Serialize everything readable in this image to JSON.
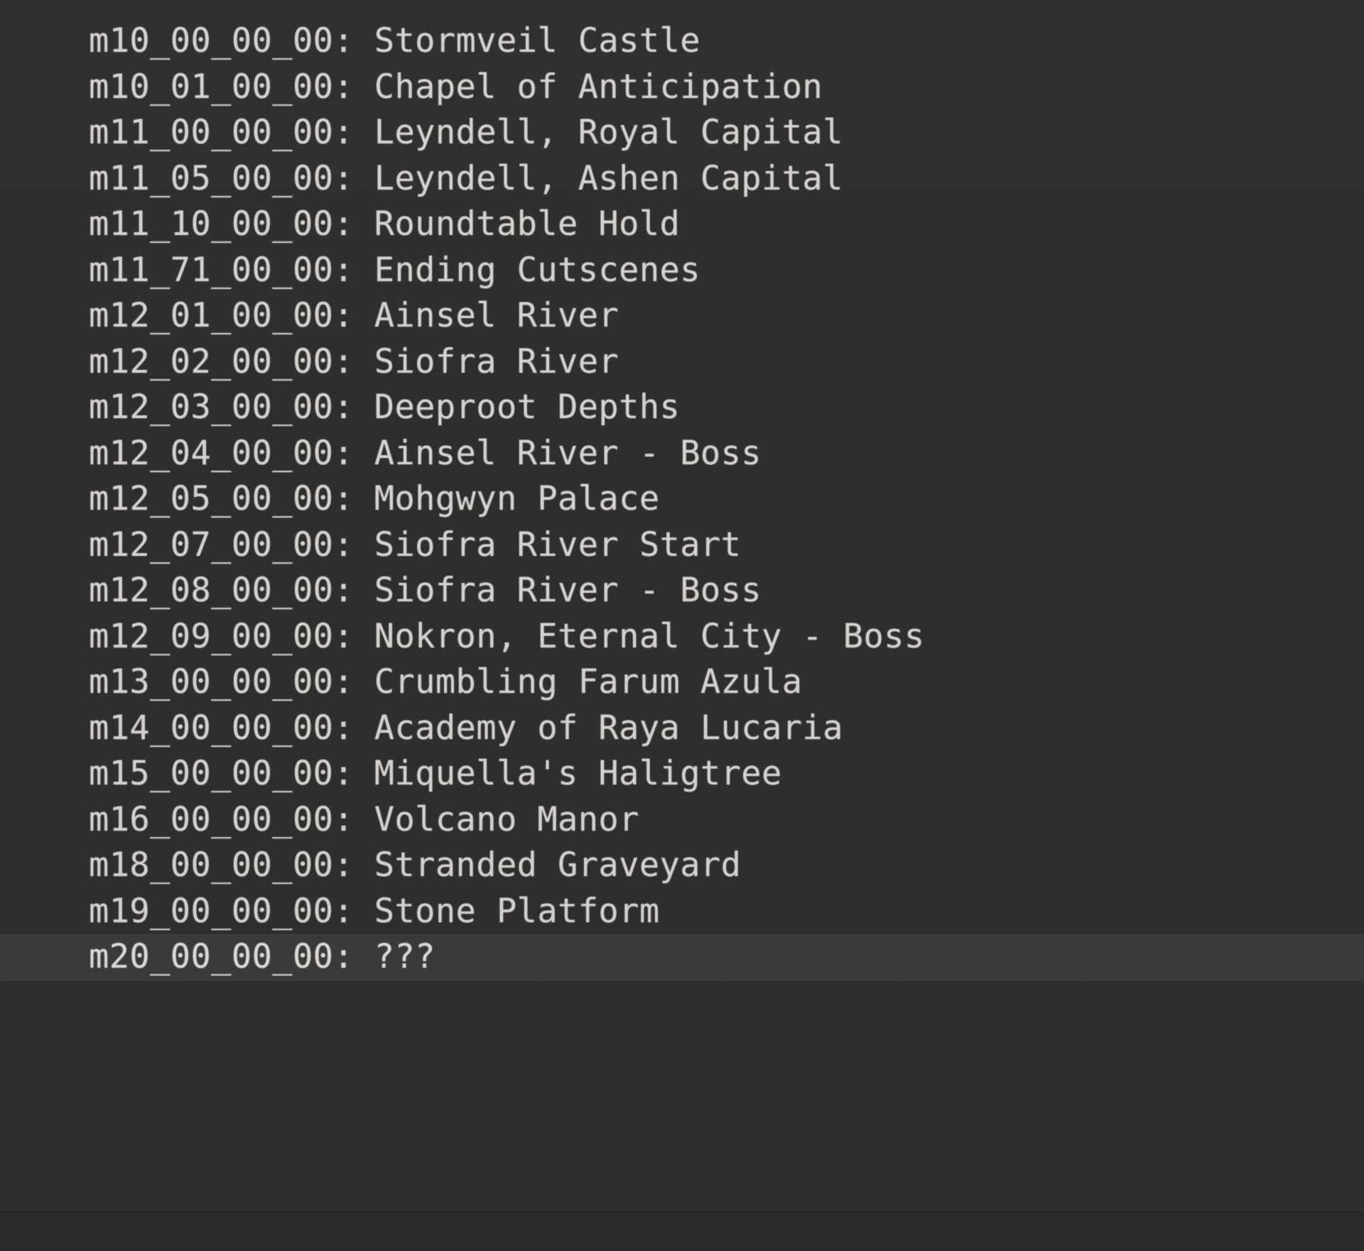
{
  "panel": {
    "background_color": "#2e2e2e",
    "text_color": "#d6d2ce",
    "selected_row_color": "#3a3a3a",
    "footer_color": "#2a2a2a",
    "separator": ": "
  },
  "map_list": {
    "rows": [
      {
        "map_id": "m10_00_00_00",
        "name": "Stormveil Castle",
        "selected": false
      },
      {
        "map_id": "m10_01_00_00",
        "name": "Chapel of Anticipation",
        "selected": false
      },
      {
        "map_id": "m11_00_00_00",
        "name": "Leyndell, Royal Capital",
        "selected": false
      },
      {
        "map_id": "m11_05_00_00",
        "name": "Leyndell, Ashen Capital",
        "selected": false
      },
      {
        "map_id": "m11_10_00_00",
        "name": "Roundtable Hold",
        "selected": false
      },
      {
        "map_id": "m11_71_00_00",
        "name": "Ending Cutscenes",
        "selected": false
      },
      {
        "map_id": "m12_01_00_00",
        "name": "Ainsel River",
        "selected": false
      },
      {
        "map_id": "m12_02_00_00",
        "name": "Siofra River",
        "selected": false
      },
      {
        "map_id": "m12_03_00_00",
        "name": "Deeproot Depths",
        "selected": false
      },
      {
        "map_id": "m12_04_00_00",
        "name": "Ainsel River - Boss",
        "selected": false
      },
      {
        "map_id": "m12_05_00_00",
        "name": "Mohgwyn Palace",
        "selected": false
      },
      {
        "map_id": "m12_07_00_00",
        "name": "Siofra River Start",
        "selected": false
      },
      {
        "map_id": "m12_08_00_00",
        "name": "Siofra River - Boss",
        "selected": false
      },
      {
        "map_id": "m12_09_00_00",
        "name": "Nokron, Eternal City - Boss",
        "selected": false
      },
      {
        "map_id": "m13_00_00_00",
        "name": "Crumbling Farum Azula",
        "selected": false
      },
      {
        "map_id": "m14_00_00_00",
        "name": "Academy of Raya Lucaria",
        "selected": false
      },
      {
        "map_id": "m15_00_00_00",
        "name": "Miquella's Haligtree",
        "selected": false
      },
      {
        "map_id": "m16_00_00_00",
        "name": "Volcano Manor",
        "selected": false
      },
      {
        "map_id": "m18_00_00_00",
        "name": "Stranded Graveyard",
        "selected": false
      },
      {
        "map_id": "m19_00_00_00",
        "name": "Stone Platform",
        "selected": false
      },
      {
        "map_id": "m20_00_00_00",
        "name": "???",
        "selected": true
      }
    ]
  }
}
